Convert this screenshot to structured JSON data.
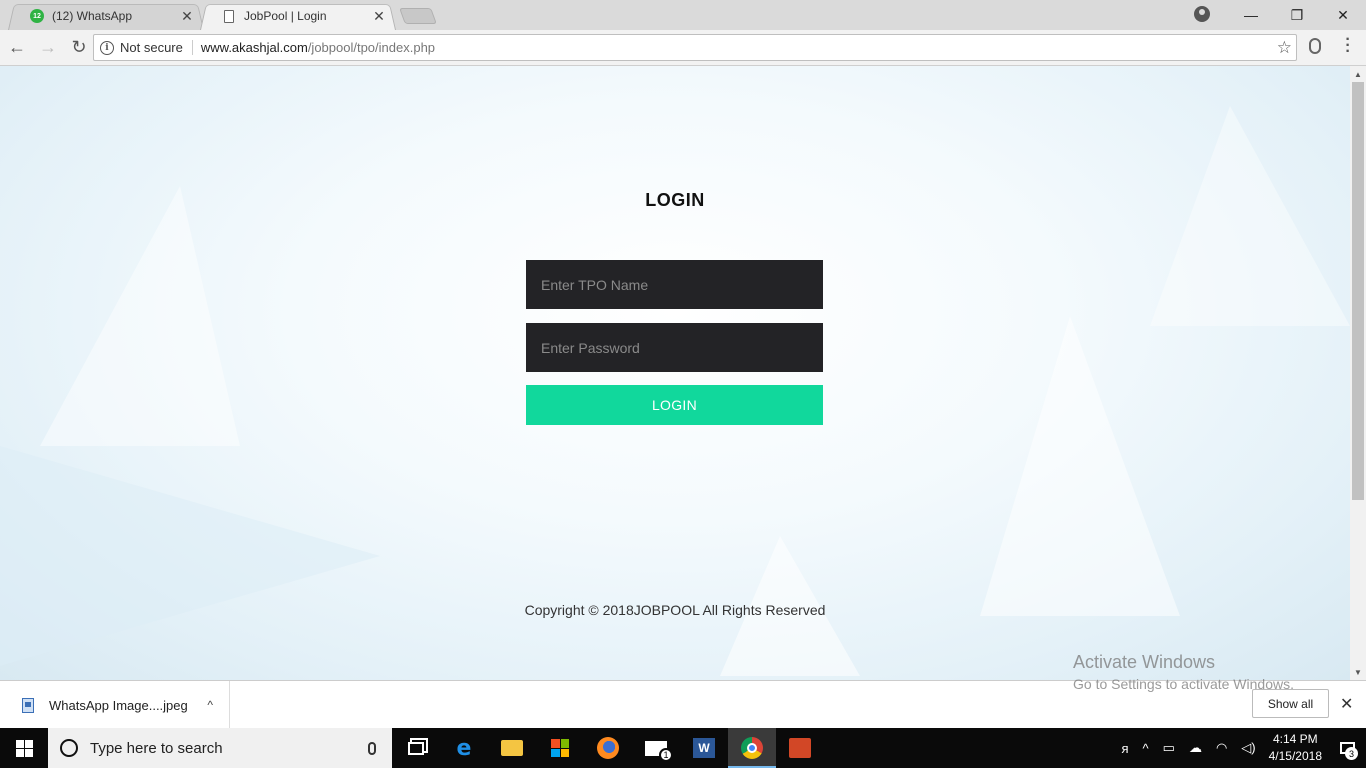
{
  "browser": {
    "tabs": [
      {
        "title": "(12) WhatsApp",
        "badge": "12",
        "close": "✕"
      },
      {
        "title": "JobPool | Login",
        "close": "✕"
      }
    ],
    "window_controls": {
      "minimize": "—",
      "maximize": "❐",
      "close": "✕"
    },
    "nav": {
      "back": "←",
      "forward": "→",
      "reload": "↻"
    },
    "security_label": "Not secure",
    "url_host": "www.akashjal.com",
    "url_path": "/jobpool/tpo/index.php",
    "bookmark_icon": "☆"
  },
  "page": {
    "title": "LOGIN",
    "name_placeholder": "Enter TPO Name",
    "password_placeholder": "Enter Password",
    "login_button": "LOGIN",
    "copyright": "Copyright © 2018JOBPOOL All Rights Reserved",
    "accent_color": "#11d89c",
    "field_color": "#232326"
  },
  "watermark": {
    "line1": "Activate Windows",
    "line2": "Go to Settings to activate Windows."
  },
  "downloads": {
    "file_name": "WhatsApp Image....jpeg",
    "caret": "^",
    "show_all": "Show all",
    "close": "✕"
  },
  "taskbar": {
    "search_placeholder": "Type here to search",
    "mail_badge": "1",
    "word_letter": "W",
    "edge_letter": "e",
    "time": "4:14 PM",
    "date": "4/15/2018",
    "notification_count": "3",
    "tray": {
      "people": "ᴙ",
      "chevron": "^"
    }
  }
}
